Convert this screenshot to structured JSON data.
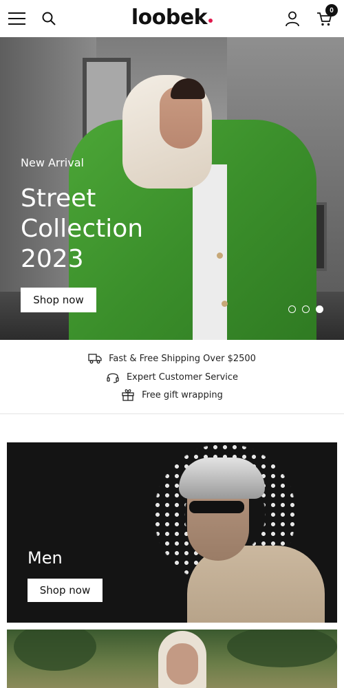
{
  "header": {
    "logo": "loobek",
    "cart_count": "0",
    "icons": [
      "menu-icon",
      "search-icon",
      "user-icon",
      "cart-icon"
    ]
  },
  "hero": {
    "kicker": "New Arrival",
    "title": "Street Collection 2023",
    "button_label": "Shop now",
    "slides": 3,
    "active_slide": 3
  },
  "features": [
    {
      "icon": "truck-icon",
      "text": "Fast & Free Shipping Over $2500"
    },
    {
      "icon": "headset-icon",
      "text": "Expert Customer Service"
    },
    {
      "icon": "gift-icon",
      "text": "Free gift wrapping"
    }
  ],
  "categories": [
    {
      "title": "Men",
      "button_label": "Shop now"
    },
    {
      "title": "",
      "button_label": ""
    }
  ],
  "colors": {
    "accent": "#e0194c",
    "hero_button_bg": "#ffffff",
    "men_card_bg": "#141414"
  }
}
